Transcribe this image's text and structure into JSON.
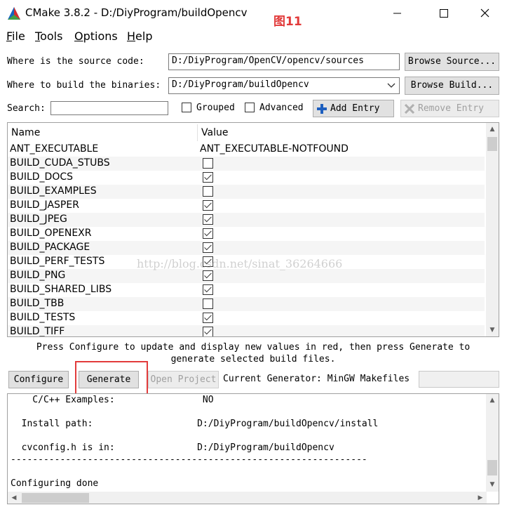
{
  "window": {
    "title": "CMake 3.8.2 - D:/DiyProgram/buildOpencv",
    "annotation": "图11",
    "min_glyph": "─",
    "max_glyph": "☐",
    "close_glyph": "✕"
  },
  "menu": [
    {
      "underline": "F",
      "rest": "ile"
    },
    {
      "underline": "T",
      "rest": "ools"
    },
    {
      "underline": "O",
      "rest": "ptions"
    },
    {
      "underline": "H",
      "rest": "elp"
    }
  ],
  "source": {
    "label": "Where is the source code:",
    "value": "D:/DiyProgram/OpenCV/opencv/sources",
    "button": "Browse Source..."
  },
  "build": {
    "label": "Where to build the binaries:",
    "value": "D:/DiyProgram/buildOpencv",
    "button": "Browse Build..."
  },
  "search": {
    "label": "Search:",
    "value": "",
    "grouped": "Grouped",
    "advanced": "Advanced",
    "add_entry": "Add Entry",
    "remove_entry": "Remove Entry"
  },
  "table": {
    "col_name": "Name",
    "col_value": "Value",
    "rows": [
      {
        "name": "ANT_EXECUTABLE",
        "value": "ANT_EXECUTABLE-NOTFOUND"
      },
      {
        "name": "BUILD_CUDA_STUBS",
        "checked": false
      },
      {
        "name": "BUILD_DOCS",
        "checked": true
      },
      {
        "name": "BUILD_EXAMPLES",
        "checked": false
      },
      {
        "name": "BUILD_JASPER",
        "checked": true
      },
      {
        "name": "BUILD_JPEG",
        "checked": true
      },
      {
        "name": "BUILD_OPENEXR",
        "checked": true
      },
      {
        "name": "BUILD_PACKAGE",
        "checked": true
      },
      {
        "name": "BUILD_PERF_TESTS",
        "checked": true
      },
      {
        "name": "BUILD_PNG",
        "checked": true
      },
      {
        "name": "BUILD_SHARED_LIBS",
        "checked": true
      },
      {
        "name": "BUILD_TBB",
        "checked": false
      },
      {
        "name": "BUILD_TESTS",
        "checked": true
      },
      {
        "name": "BUILD_TIFF",
        "checked": true
      }
    ]
  },
  "watermark": "http://blog.csdn.net/sinat_36264666",
  "hint": {
    "line1": "Press Configure to update and display new values in red, then press Generate to",
    "line2": "generate selected build files."
  },
  "actions": {
    "configure": "Configure",
    "generate": "Generate",
    "open_project": "Open Project",
    "generator_label": "Current Generator: MinGW Makefiles"
  },
  "output": {
    "lines": [
      "    C/C++ Examples:                NO",
      "",
      "  Install path:                   D:/DiyProgram/buildOpencv/install",
      "",
      "  cvconfig.h is in:               D:/DiyProgram/buildOpencv",
      "-----------------------------------------------------------------",
      "",
      "Configuring done"
    ]
  },
  "colors": {
    "annotation": "#e23b3b",
    "button_face": "#e1e1e1",
    "highlight_box": "#e23b3b"
  }
}
